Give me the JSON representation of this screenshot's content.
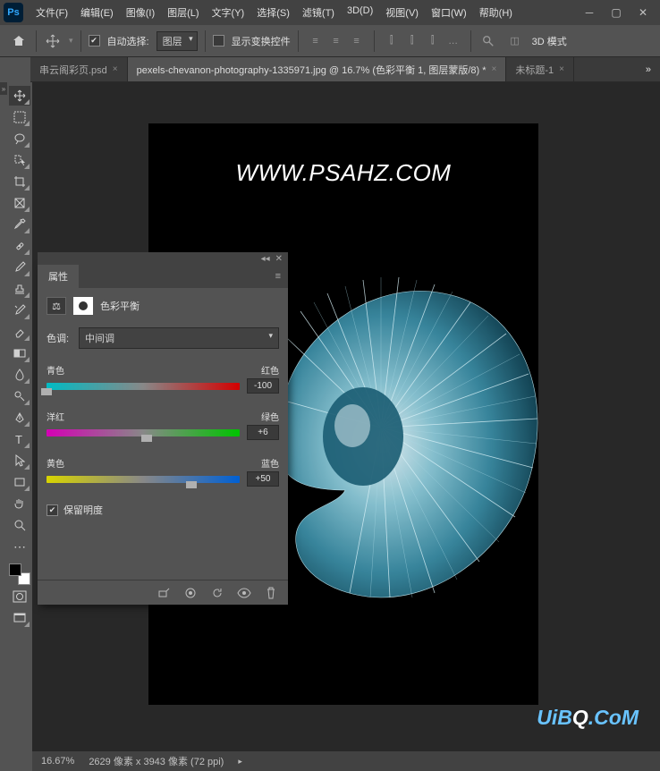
{
  "menus": [
    "文件(F)",
    "编辑(E)",
    "图像(I)",
    "图层(L)",
    "文字(Y)",
    "选择(S)",
    "滤镜(T)",
    "3D(D)",
    "视图(V)",
    "窗口(W)",
    "帮助(H)"
  ],
  "options": {
    "auto_select_label": "自动选择:",
    "auto_select_target": "图层",
    "show_transform": "显示变换控件",
    "mode3d": "3D 模式"
  },
  "tabs": [
    {
      "label": "串云阁彩页.psd",
      "active": false
    },
    {
      "label": "pexels-chevanon-photography-1335971.jpg @ 16.7% (色彩平衡 1, 图层蒙版/8) *",
      "active": true
    },
    {
      "label": "未标题-1",
      "active": false
    }
  ],
  "doc_text": "WWW.PSAHZ.COM",
  "watermark": {
    "prefix": "UiB",
    "q": "Q",
    "suffix": ".CoM"
  },
  "panel": {
    "title": "属性",
    "adjustment_name": "色彩平衡",
    "tone_label": "色调:",
    "tone_value": "中间调",
    "sliders": [
      {
        "left": "青色",
        "right": "红色",
        "value": "-100",
        "pos": 0,
        "track": "track-cr"
      },
      {
        "left": "洋红",
        "right": "绿色",
        "value": "+6",
        "pos": 52,
        "track": "track-mg"
      },
      {
        "left": "黄色",
        "right": "蓝色",
        "value": "+50",
        "pos": 75,
        "track": "track-yb"
      }
    ],
    "preserve_label": "保留明度"
  },
  "status": {
    "zoom": "16.67%",
    "dims": "2629 像素 x 3943 像素 (72 ppi)"
  }
}
